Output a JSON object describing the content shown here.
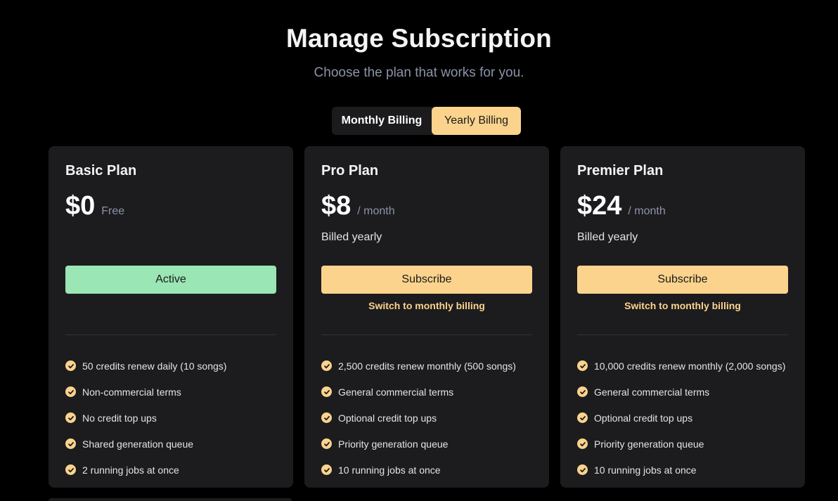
{
  "header": {
    "title": "Manage Subscription",
    "subtitle": "Choose the plan that works for you."
  },
  "billing_toggle": {
    "monthly_label": "Monthly Billing",
    "yearly_label": "Yearly Billing",
    "selected": "yearly"
  },
  "colors": {
    "accent": "#fbd38d",
    "active": "#9ae6b4",
    "card_bg": "#1c1c1e",
    "page_bg": "#000000"
  },
  "plans": [
    {
      "name": "Basic Plan",
      "price": "$0",
      "price_suffix": "Free",
      "billed": "",
      "cta_label": "Active",
      "switch_label": "",
      "features": [
        "50 credits renew daily (10 songs)",
        "Non-commercial terms",
        "No credit top ups",
        "Shared generation queue",
        "2 running jobs at once"
      ]
    },
    {
      "name": "Pro Plan",
      "price": "$8",
      "price_suffix": "/ month",
      "billed": "Billed yearly",
      "cta_label": "Subscribe",
      "switch_label": "Switch to monthly billing",
      "features": [
        "2,500 credits renew monthly (500 songs)",
        "General commercial terms",
        "Optional credit top ups",
        "Priority generation queue",
        "10 running jobs at once"
      ]
    },
    {
      "name": "Premier Plan",
      "price": "$24",
      "price_suffix": "/ month",
      "billed": "Billed yearly",
      "cta_label": "Subscribe",
      "switch_label": "Switch to monthly billing",
      "features": [
        "10,000 credits renew monthly (2,000 songs)",
        "General commercial terms",
        "Optional credit top ups",
        "Priority generation queue",
        "10 running jobs at once"
      ]
    }
  ],
  "icons": {
    "feature_check": "check-circle-icon"
  }
}
